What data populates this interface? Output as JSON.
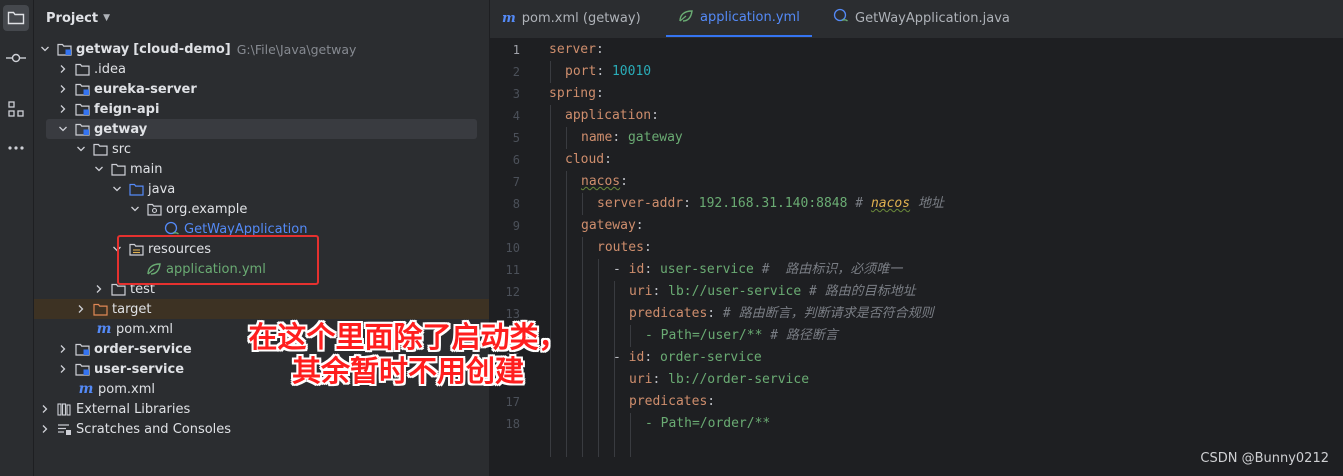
{
  "activity_bar": {
    "items": [
      {
        "icon": "folder-icon",
        "active": true
      },
      {
        "icon": "commit-icon",
        "active": false
      },
      {
        "icon": "structure-icon",
        "active": false
      },
      {
        "icon": "more-icon",
        "active": false
      }
    ]
  },
  "project": {
    "title": "Project",
    "tree": [
      {
        "label": "getway",
        "tag": "[cloud-demo]",
        "hint": "G:\\File\\Java\\getway"
      },
      {
        "label": ".idea"
      },
      {
        "label": "eureka-server"
      },
      {
        "label": "feign-api"
      },
      {
        "label": "getway"
      },
      {
        "label": "src"
      },
      {
        "label": "main"
      },
      {
        "label": "java"
      },
      {
        "label": "org.example"
      },
      {
        "label": "GetWayApplication"
      },
      {
        "label": "resources"
      },
      {
        "label": "application.yml"
      },
      {
        "label": "test"
      },
      {
        "label": "target"
      },
      {
        "label": "pom.xml"
      },
      {
        "label": "order-service"
      },
      {
        "label": "user-service"
      },
      {
        "label": "pom.xml"
      },
      {
        "label": "External Libraries"
      },
      {
        "label": "Scratches and Consoles"
      }
    ]
  },
  "editor": {
    "tabs": [
      {
        "label": "pom.xml (getway)"
      },
      {
        "label": "application.yml"
      },
      {
        "label": "GetWayApplication.java"
      }
    ],
    "line_numbers": [
      "1",
      "2",
      "3",
      "4",
      "5",
      "6",
      "7",
      "8",
      "9",
      "10",
      "11",
      "12",
      "13",
      "14",
      "15",
      "16",
      "17",
      "18"
    ],
    "code": {
      "l1": {
        "key": "server",
        "colon": ":"
      },
      "l2": {
        "key": "port",
        "colon": ": ",
        "value": "10010"
      },
      "l3": {
        "key": "spring",
        "colon": ":"
      },
      "l4": {
        "key": "application",
        "colon": ":"
      },
      "l5": {
        "key": "name",
        "colon": ": ",
        "value": "gateway"
      },
      "l6": {
        "key": "cloud",
        "colon": ":"
      },
      "l7": {
        "key": "nacos",
        "colon": ":"
      },
      "l8": {
        "key": "server-addr",
        "colon": ": ",
        "value": "192.168.31.140:8848",
        "comment_hash": " # ",
        "comment_word": "nacos",
        "comment_rest": " 地址"
      },
      "l9": {
        "key": "gateway",
        "colon": ":"
      },
      "l10": {
        "key": "routes",
        "colon": ":"
      },
      "l11": {
        "dash": "- ",
        "key": "id",
        "colon": ": ",
        "value": "user-service",
        "comment": " #  路由标识，必须唯一"
      },
      "l12": {
        "key": "uri",
        "colon": ": ",
        "value": "lb://user-service",
        "comment": " # 路由的目标地址"
      },
      "l13": {
        "key": "predicates",
        "colon": ":",
        "comment": " # 路由断言，判断请求是否符合规则"
      },
      "l14": {
        "value": "- Path=/user/**",
        "comment": " # 路径断言"
      },
      "l15": {
        "dash": "- ",
        "key": "id",
        "colon": ": ",
        "value": "order-service"
      },
      "l16": {
        "key": "uri",
        "colon": ": ",
        "value": "lb://order-service"
      },
      "l17": {
        "key": "predicates",
        "colon": ":"
      },
      "l18": {
        "value": "- Path=/order/**"
      }
    }
  },
  "annotation": {
    "line1": "在这个里面除了启动类，",
    "line2": "其余暂时不用创建"
  },
  "watermark": "CSDN @Bunny0212",
  "colors": {
    "accent": "#3574f0",
    "annotation_red": "#ff1e1e",
    "yaml_key": "#cf8e6d",
    "yaml_value": "#6aab73",
    "yaml_number": "#2aacb8"
  }
}
